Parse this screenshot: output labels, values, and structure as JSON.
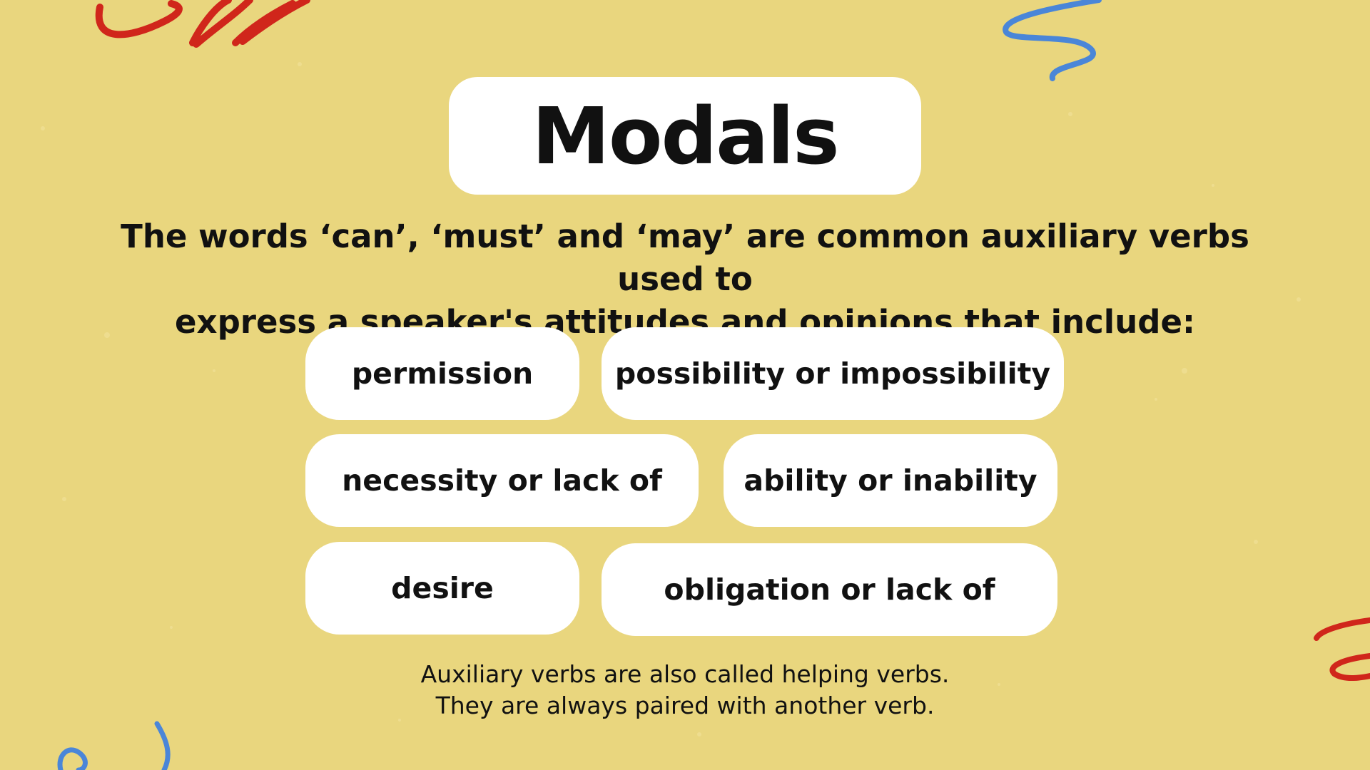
{
  "title": "Modals",
  "intro": {
    "line1": "The words ‘can’, ‘must’ and ‘may’ are common auxiliary verbs used to",
    "line2": "express a speaker's attitudes and opinions that include:"
  },
  "categories": [
    "permission",
    "possibility or impossibility",
    "necessity or lack of",
    "ability or inability",
    "desire",
    "obligation or lack of"
  ],
  "footnote": {
    "line1": "Auxiliary verbs are also called helping verbs.",
    "line2": "They are always paired with another verb."
  },
  "colors": {
    "background": "#E9D67E",
    "card": "#FFFFFF",
    "text": "#111111",
    "scribble_red": "#D0261B",
    "scribble_blue": "#4A86D8"
  }
}
